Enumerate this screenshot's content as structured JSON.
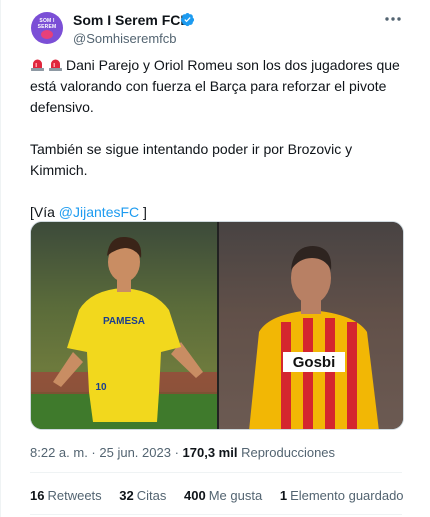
{
  "author": {
    "name": "Som I Serem FCB",
    "handle": "@Somhiseremfcb",
    "avatar_text": "SOM I SEREM",
    "avatar_color": "#7b4fd6"
  },
  "tweet": {
    "paragraph1": "Dani Parejo y Oriol Romeu son los dos jugadores que está valorando con fuerza el Barça para reforzar el pivote defensivo.",
    "paragraph2": "También se sigue intentando poder ir por Brozovic y Kimmich.",
    "via_prefix": "[Vía ",
    "via_link": "@JijantesFC",
    "via_suffix": " ]",
    "emoji": [
      "police-car-light",
      "police-car-light"
    ]
  },
  "media": {
    "left_shirt_text": "PAMESA",
    "left_shirt_number": "10",
    "right_shirt_text": "Gosbi"
  },
  "meta": {
    "time": "8:22 a. m.",
    "separator": " · ",
    "date": "25 jun. 2023",
    "views_value": "170,3 mil",
    "views_label": "Reproducciones"
  },
  "stats": [
    {
      "value": "16",
      "label": "Retweets"
    },
    {
      "value": "32",
      "label": "Citas"
    },
    {
      "value": "400",
      "label": "Me gusta"
    },
    {
      "value": "1",
      "label": "Elemento guardado"
    }
  ],
  "colors": {
    "link": "#1d9bf0",
    "verified": "#1d9bf0",
    "secondary_text": "#536471"
  }
}
